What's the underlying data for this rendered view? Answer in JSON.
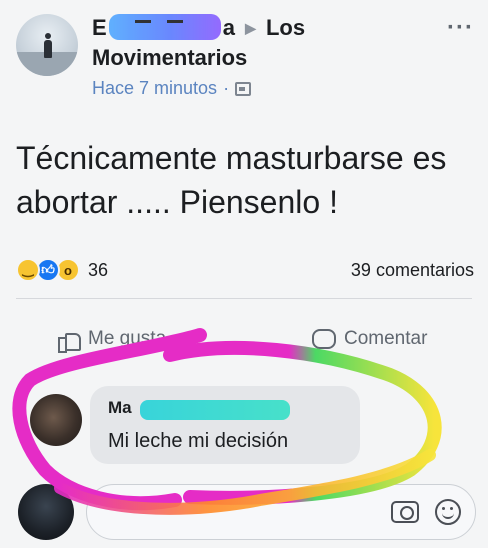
{
  "post": {
    "author_prefix": "E",
    "author_suffix": "a",
    "group_name": "Los",
    "group_name_line2": "Movimentarios",
    "timestamp": "Hace 7 minutos",
    "text": "Técnicamente masturbarse es abortar ..... Piensenlo !"
  },
  "reactions": {
    "icons": [
      "haha-icon",
      "like-icon",
      "wow-icon"
    ],
    "count": "36",
    "comments_label": "39 comentarios"
  },
  "actions": {
    "like_label": "Me gusta",
    "comment_label": "Comentar"
  },
  "comment": {
    "author_visible": "Ma",
    "text": "Mi leche mi decisión"
  },
  "composer": {
    "icons": [
      "camera-icon",
      "emoji-icon"
    ]
  },
  "colors": {
    "name_highlight": "#5b7cff",
    "comment_name_highlight": "#2fd3d9",
    "link_blue": "#5b84c0",
    "scribble": [
      "#e52cc6",
      "#f7e43b",
      "#4cd964",
      "#ff8a2a"
    ]
  }
}
